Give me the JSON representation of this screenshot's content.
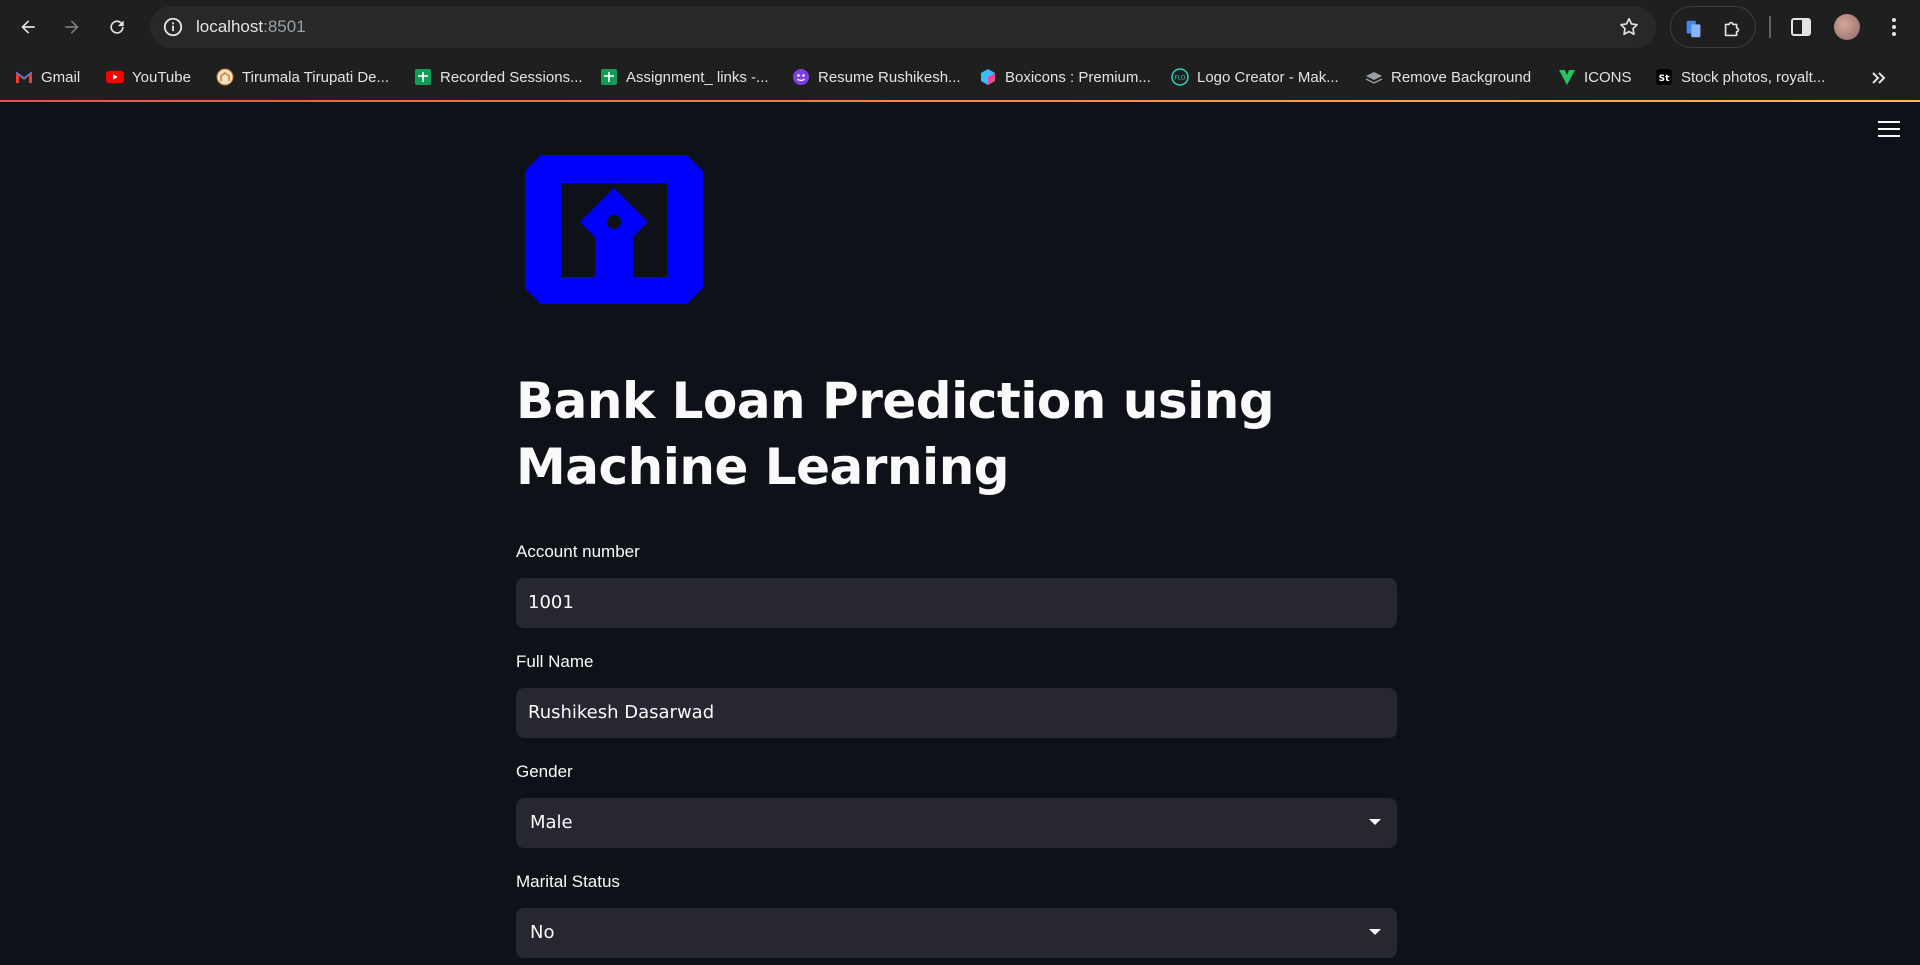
{
  "browser": {
    "url_host": "localhost",
    "url_port": ":8501",
    "bookmarks": [
      {
        "label": "Gmail",
        "icon": "gmail-icon"
      },
      {
        "label": "YouTube",
        "icon": "youtube-icon"
      },
      {
        "label": "Tirumala Tirupati De...",
        "icon": "temple-icon"
      },
      {
        "label": "Recorded Sessions...",
        "icon": "sheets-icon"
      },
      {
        "label": "Assignment_ links -...",
        "icon": "sheets-icon"
      },
      {
        "label": "Resume Rushikesh...",
        "icon": "smiley-icon"
      },
      {
        "label": "Boxicons : Premium...",
        "icon": "box-icon"
      },
      {
        "label": "Logo Creator - Mak...",
        "icon": "flo-icon"
      },
      {
        "label": "Remove Background",
        "icon": "layers-icon"
      },
      {
        "label": "ICONS",
        "icon": "v-icon"
      },
      {
        "label": "Stock photos, royalt...",
        "icon": "st-icon"
      }
    ],
    "st_icon_text": "St",
    "flo_icon_text": "FLO"
  },
  "app": {
    "title": "Bank Loan Prediction using Machine Learning",
    "logo_color": "#0000ff",
    "fields": [
      {
        "label": "Account number",
        "value": "1001",
        "type": "text"
      },
      {
        "label": "Full Name",
        "value": "Rushikesh Dasarwad",
        "type": "text"
      },
      {
        "label": "Gender",
        "value": "Male",
        "type": "select"
      },
      {
        "label": "Marital Status",
        "value": "No",
        "type": "select"
      }
    ]
  }
}
